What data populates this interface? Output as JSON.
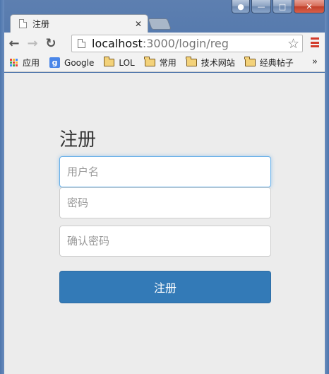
{
  "browser": {
    "tab": {
      "title": "注册"
    },
    "url": {
      "host": "localhost",
      "path": ":3000/login/reg"
    },
    "bookmarks": [
      {
        "label": "应用",
        "icon": "apps-icon"
      },
      {
        "label": "Google",
        "icon": "google-icon"
      },
      {
        "label": "LOL",
        "icon": "folder-icon"
      },
      {
        "label": "常用",
        "icon": "folder-icon"
      },
      {
        "label": "技术网站",
        "icon": "folder-icon"
      },
      {
        "label": "经典帖子",
        "icon": "folder-icon"
      }
    ],
    "google_glyph": "g",
    "overflow_glyph": "»"
  },
  "form": {
    "title": "注册",
    "username_placeholder": "用户名",
    "password_placeholder": "密码",
    "confirm_placeholder": "确认密码",
    "submit_label": "注册"
  },
  "colors": {
    "primary": "#337ab7",
    "focus": "#66afe9",
    "page_bg": "#ececec"
  }
}
